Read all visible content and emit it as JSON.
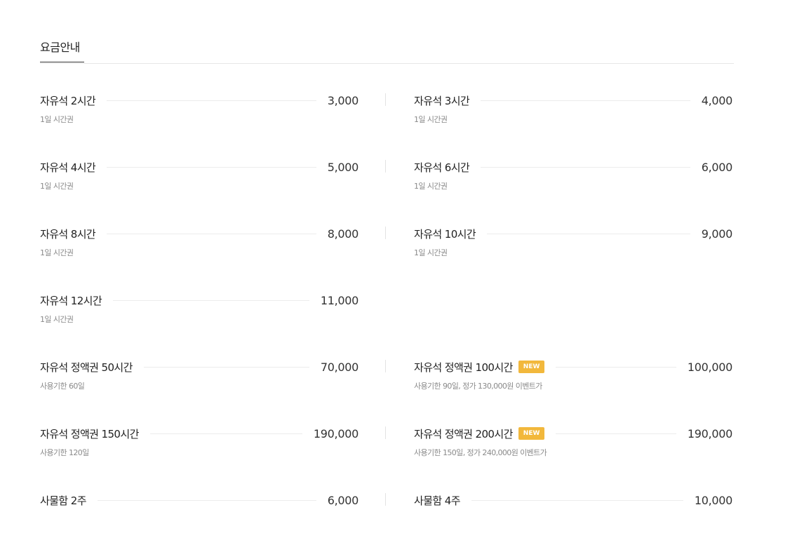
{
  "section_title": "요금안내",
  "rows": [
    {
      "left": {
        "name": "자유석 2시간",
        "price": "3,000",
        "sub": "1일 시간권"
      },
      "right": {
        "name": "자유석 3시간",
        "price": "4,000",
        "sub": "1일 시간권"
      }
    },
    {
      "left": {
        "name": "자유석 4시간",
        "price": "5,000",
        "sub": "1일 시간권"
      },
      "right": {
        "name": "자유석 6시간",
        "price": "6,000",
        "sub": "1일 시간권"
      }
    },
    {
      "left": {
        "name": "자유석 8시간",
        "price": "8,000",
        "sub": "1일 시간권"
      },
      "right": {
        "name": "자유석 10시간",
        "price": "9,000",
        "sub": "1일 시간권"
      }
    },
    {
      "left": {
        "name": "자유석 12시간",
        "price": "11,000",
        "sub": "1일 시간권"
      }
    },
    {
      "left": {
        "name": "자유석 정액권 50시간",
        "price": "70,000",
        "sub": "사용기한 60일"
      },
      "right": {
        "name": "자유석 정액권 100시간",
        "price": "100,000",
        "sub": "사용기한 90일, 정가 130,000원 이벤트가",
        "badge": "NEW"
      }
    },
    {
      "left": {
        "name": "자유석 정액권 150시간",
        "price": "190,000",
        "sub": "사용기한 120일"
      },
      "right": {
        "name": "자유석 정액권 200시간",
        "price": "190,000",
        "sub": "사용기한 150일, 정가 240,000원 이벤트가",
        "badge": "NEW"
      }
    },
    {
      "left": {
        "name": "사물함 2주",
        "price": "6,000"
      },
      "right": {
        "name": "사물함 4주",
        "price": "10,000"
      }
    }
  ],
  "colors": {
    "badge": "#f2b83c",
    "line": "#ececec",
    "subtext": "#8a8a8a",
    "tab_underline": "#333333"
  }
}
